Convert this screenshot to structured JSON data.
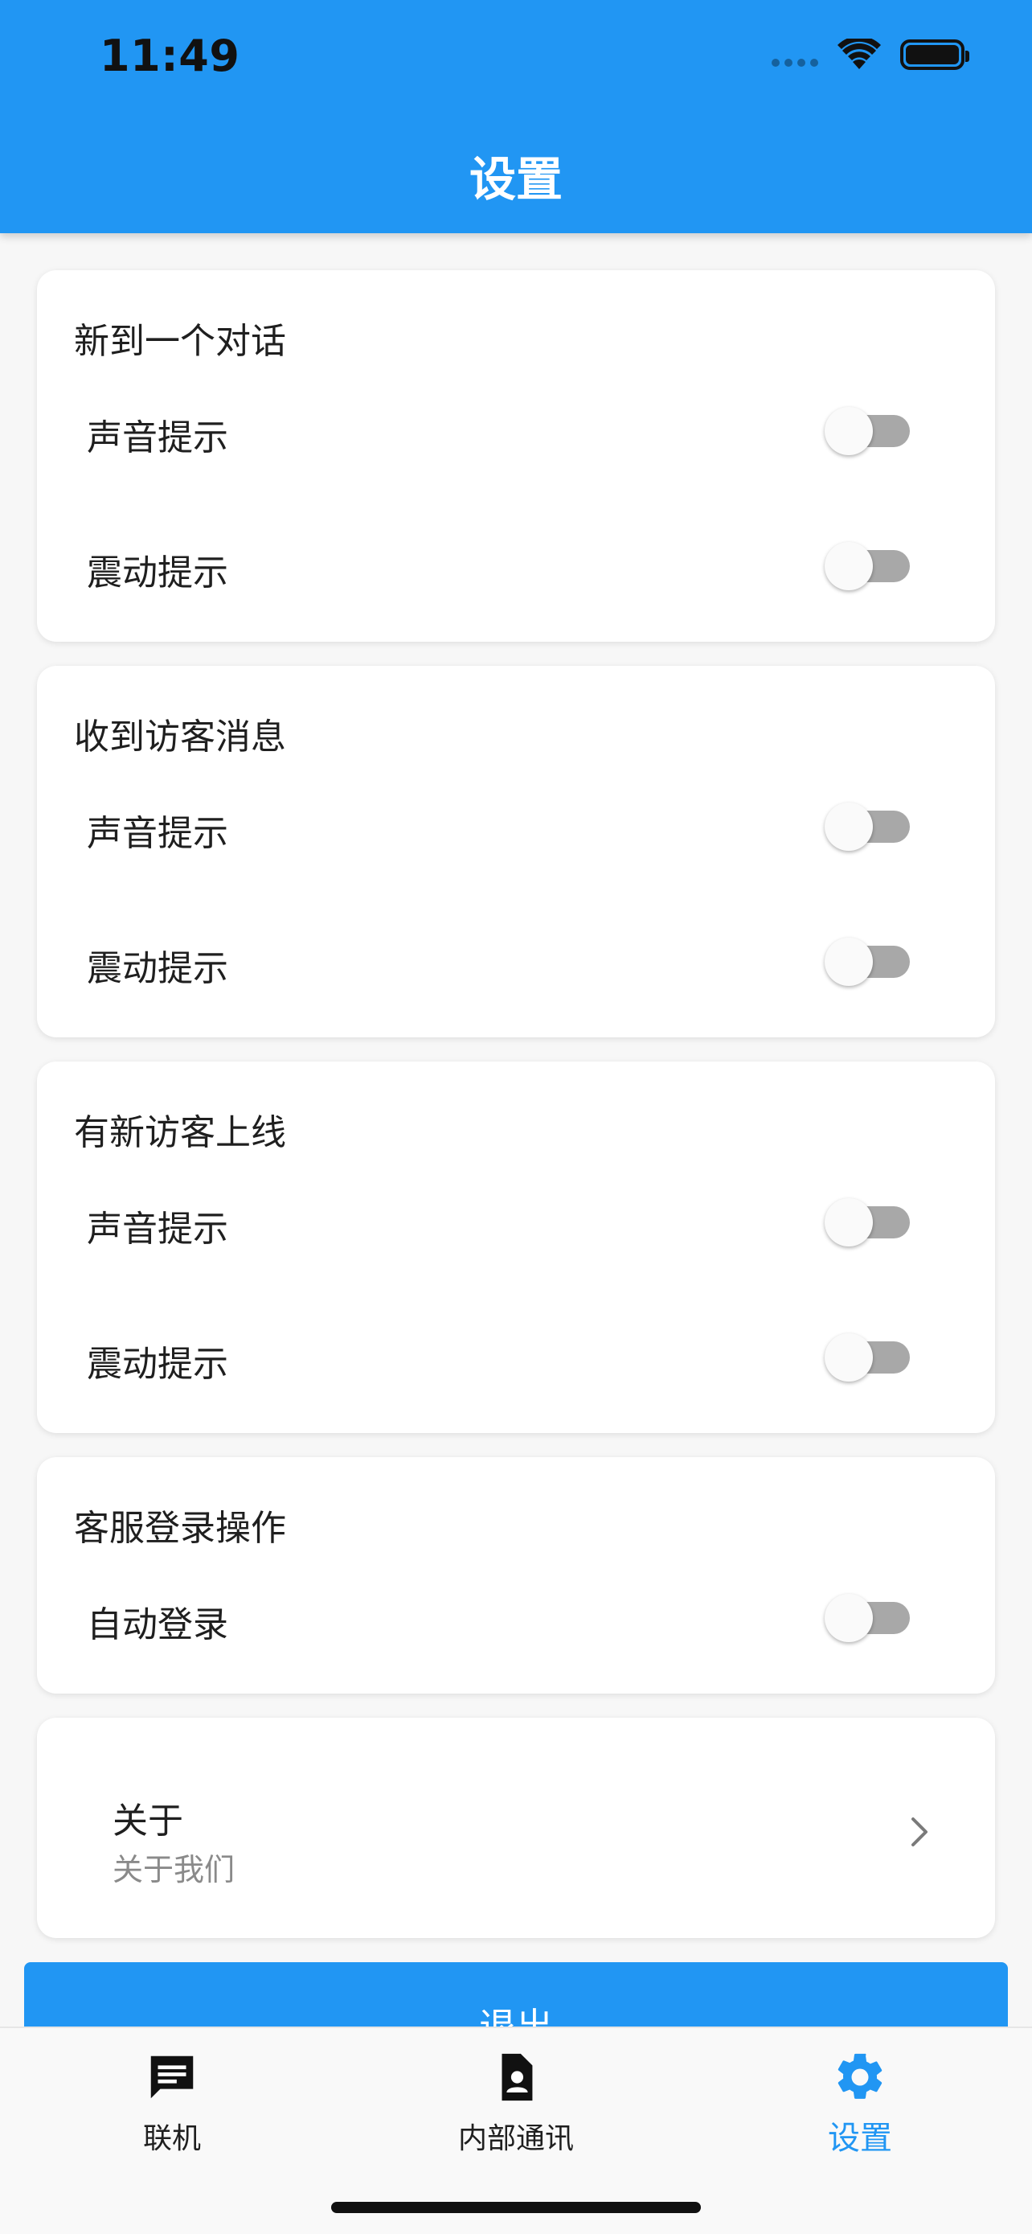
{
  "status_bar": {
    "time": "11:49"
  },
  "header": {
    "title": "设置"
  },
  "sections": [
    {
      "title": "新到一个对话",
      "rows": [
        {
          "label": "声音提示",
          "enabled": false
        },
        {
          "label": "震动提示",
          "enabled": false
        }
      ]
    },
    {
      "title": "收到访客消息",
      "rows": [
        {
          "label": "声音提示",
          "enabled": false
        },
        {
          "label": "震动提示",
          "enabled": false
        }
      ]
    },
    {
      "title": "有新访客上线",
      "rows": [
        {
          "label": "声音提示",
          "enabled": false
        },
        {
          "label": "震动提示",
          "enabled": false
        }
      ]
    },
    {
      "title": "客服登录操作",
      "rows": [
        {
          "label": "自动登录",
          "enabled": false
        }
      ]
    }
  ],
  "about": {
    "title": "关于",
    "subtitle": "关于我们"
  },
  "logout": {
    "label": "退出"
  },
  "bottom_nav": {
    "items": [
      {
        "label": "联机",
        "icon": "chat-icon",
        "active": false
      },
      {
        "label": "内部通讯",
        "icon": "contact-card-icon",
        "active": false
      },
      {
        "label": "设置",
        "icon": "gear-icon",
        "active": true
      }
    ]
  },
  "colors": {
    "primary": "#2196F3",
    "switch_track_off": "#a8a8a8",
    "switch_thumb_off": "#fafafa",
    "background": "#f7f7f7"
  }
}
